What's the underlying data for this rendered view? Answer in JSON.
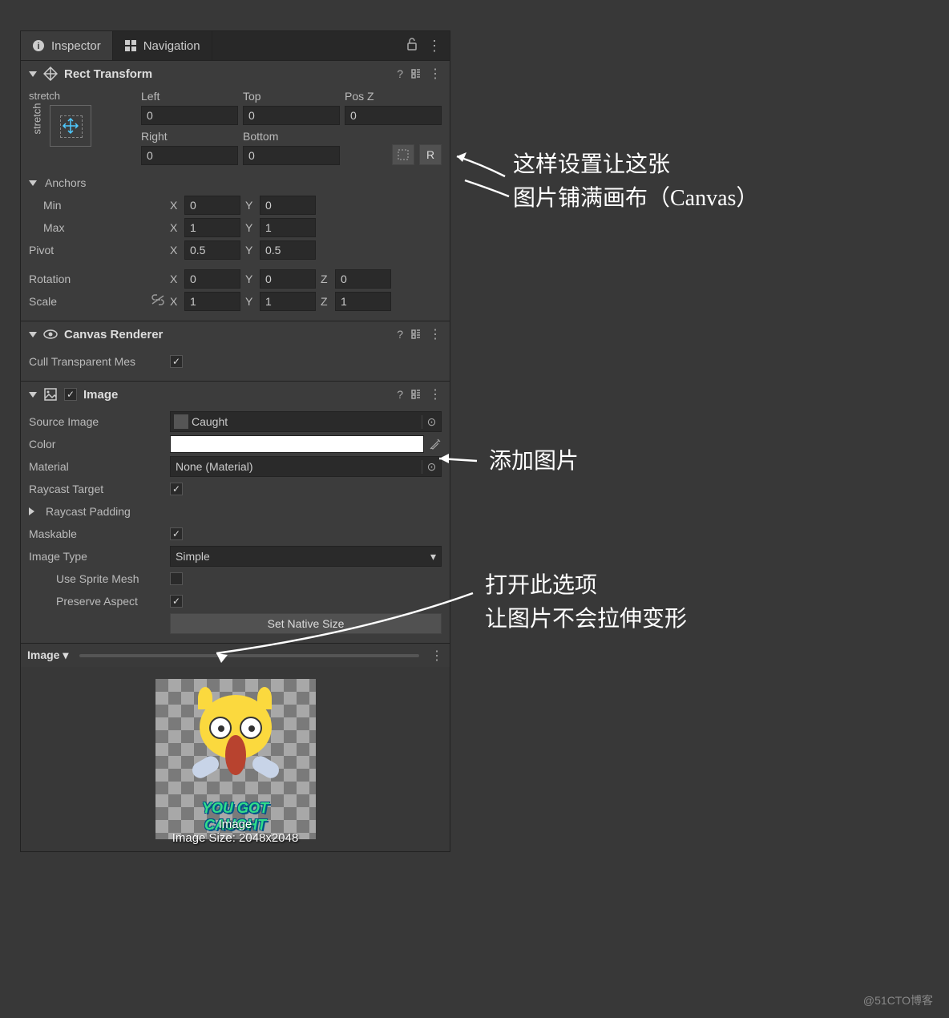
{
  "tabs": {
    "inspector": "Inspector",
    "navigation": "Navigation"
  },
  "rect": {
    "title": "Rect Transform",
    "stretch": "stretch",
    "left": "Left",
    "top": "Top",
    "posz": "Pos Z",
    "right": "Right",
    "bottom": "Bottom",
    "v_left": "0",
    "v_top": "0",
    "v_posz": "0",
    "v_right": "0",
    "v_bottom": "0",
    "anchors": "Anchors",
    "min": "Min",
    "max": "Max",
    "min_x": "0",
    "min_y": "0",
    "max_x": "1",
    "max_y": "1",
    "pivot": "Pivot",
    "pivot_x": "0.5",
    "pivot_y": "0.5",
    "rotation": "Rotation",
    "rot_x": "0",
    "rot_y": "0",
    "rot_z": "0",
    "scale": "Scale",
    "sc_x": "1",
    "sc_y": "1",
    "sc_z": "1",
    "x": "X",
    "y": "Y",
    "z": "Z",
    "r_btn": "R"
  },
  "canvas": {
    "title": "Canvas Renderer",
    "cull": "Cull Transparent Mes"
  },
  "image": {
    "title": "Image",
    "source": "Source Image",
    "source_val": "Caught",
    "color": "Color",
    "material": "Material",
    "material_val": "None (Material)",
    "raycast_target": "Raycast Target",
    "raycast_padding": "Raycast Padding",
    "maskable": "Maskable",
    "image_type": "Image Type",
    "image_type_val": "Simple",
    "use_sprite": "Use Sprite Mesh",
    "preserve": "Preserve Aspect",
    "set_native": "Set Native Size"
  },
  "preview": {
    "name": "Image",
    "label": "Image",
    "size": "Image Size: 2048x2048",
    "caption": "YOU GOT CAUGHT"
  },
  "annotations": {
    "a1": "这样设置让这张\n图片铺满画布（Canvas）",
    "a2": "添加图片",
    "a3": "打开此选项\n让图片不会拉伸变形"
  },
  "watermark": "@51CTO博客"
}
